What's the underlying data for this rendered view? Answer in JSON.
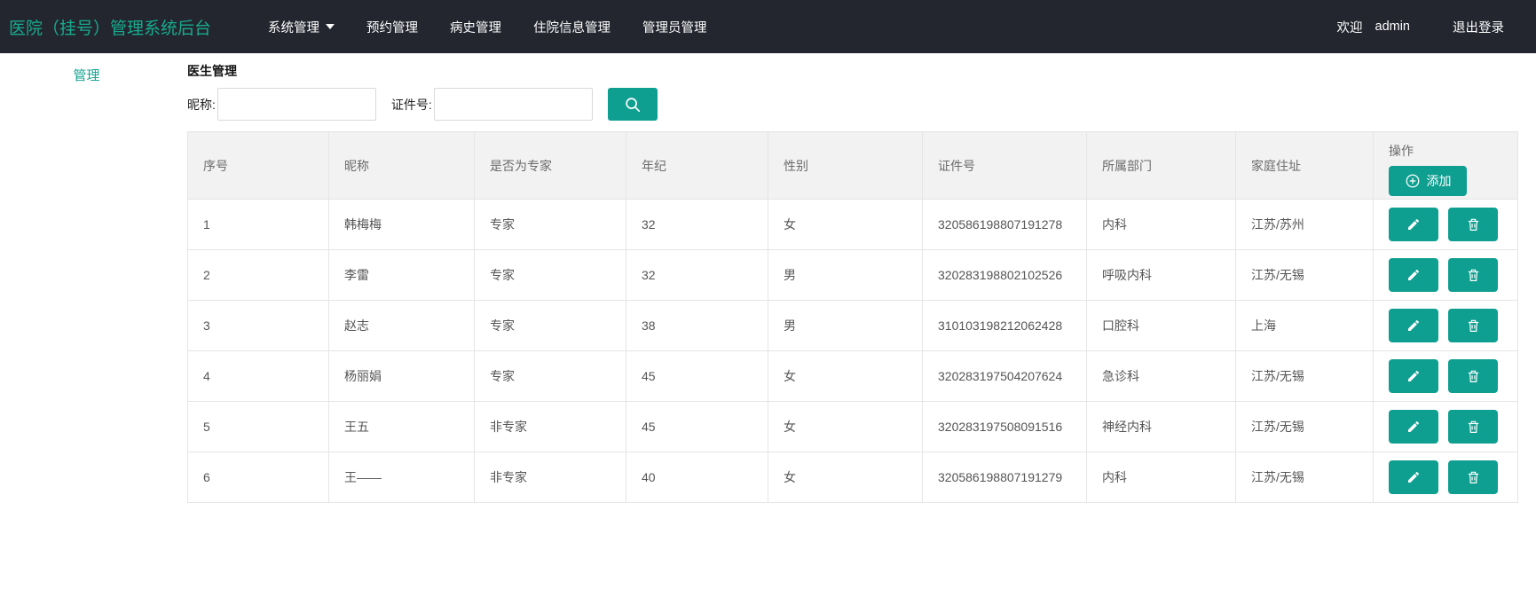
{
  "colors": {
    "accent": "#0f9f90",
    "navbar_bg": "#23262e",
    "brand": "#17ab8f"
  },
  "navbar": {
    "brand": "医院（挂号）管理系统后台",
    "items": [
      {
        "label": "系统管理"
      },
      {
        "label": "预约管理"
      },
      {
        "label": "病史管理"
      },
      {
        "label": "住院信息管理"
      },
      {
        "label": "管理员管理"
      }
    ],
    "welcome": "欢迎",
    "username": "admin",
    "logout": "退出登录"
  },
  "sidebar": {
    "items": [
      {
        "label": "管理"
      }
    ]
  },
  "main": {
    "title": "医生管理",
    "search": {
      "nickname_label": "昵称:",
      "nickname_value": "",
      "idcard_label": "证件号:",
      "idcard_value": ""
    },
    "table": {
      "headers": [
        "序号",
        "昵称",
        "是否为专家",
        "年纪",
        "性别",
        "证件号",
        "所属部门",
        "家庭住址",
        "操作"
      ],
      "add_label": "添加",
      "rows": [
        {
          "no": "1",
          "nickname": "韩梅梅",
          "expert": "专家",
          "age": "32",
          "gender": "女",
          "idcard": "320586198807191278",
          "dept": "内科",
          "address": "江苏/苏州"
        },
        {
          "no": "2",
          "nickname": "李雷",
          "expert": "专家",
          "age": "32",
          "gender": "男",
          "idcard": "320283198802102526",
          "dept": "呼吸内科",
          "address": "江苏/无锡"
        },
        {
          "no": "3",
          "nickname": "赵志",
          "expert": "专家",
          "age": "38",
          "gender": "男",
          "idcard": "310103198212062428",
          "dept": "口腔科",
          "address": "上海"
        },
        {
          "no": "4",
          "nickname": "杨丽娟",
          "expert": "专家",
          "age": "45",
          "gender": "女",
          "idcard": "320283197504207624",
          "dept": "急诊科",
          "address": "江苏/无锡"
        },
        {
          "no": "5",
          "nickname": "王五",
          "expert": "非专家",
          "age": "45",
          "gender": "女",
          "idcard": "320283197508091516",
          "dept": "神经内科",
          "address": "江苏/无锡"
        },
        {
          "no": "6",
          "nickname": "王——",
          "expert": "非专家",
          "age": "40",
          "gender": "女",
          "idcard": "320586198807191279",
          "dept": "内科",
          "address": "江苏/无锡"
        }
      ]
    }
  }
}
